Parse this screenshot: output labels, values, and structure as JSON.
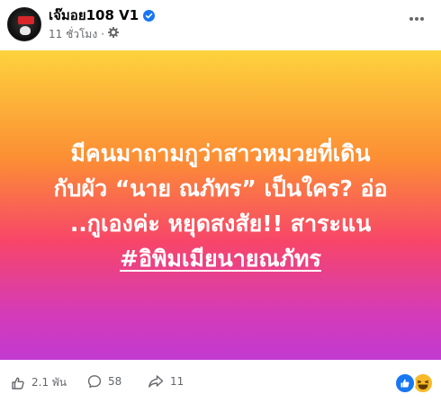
{
  "header": {
    "page_name": "เจ๊มอย108 V1",
    "time_text": "11 ชั่วโมง",
    "separator": "·"
  },
  "post": {
    "text_lines": [
      "มีคนมาถามกูว่าสาวหมวยที่เดิน",
      "กับผัว “นาย ณภัทร” เป็นใคร? อ่อ",
      "..กูเองค่ะ หยุดสงสัย!! สาระแน"
    ],
    "hashtag": "#อิพิมเมียนายณภัทร"
  },
  "footer": {
    "like_count": "2.1 พัน",
    "comment_count": "58",
    "share_count": "11"
  },
  "colors": {
    "brand_blue": "#1877f2",
    "gradient_top": "#fdd33d",
    "gradient_mid": "#f7456a",
    "gradient_bottom": "#c13ad0",
    "haha_yellow": "#f7b928",
    "meta_gray": "#65676b"
  },
  "icons": {
    "verified": "verified-badge-icon",
    "privacy": "public-gear-icon",
    "more": "more-options-icon",
    "like": "thumbs-up-icon",
    "comment": "comment-bubble-icon",
    "share": "share-arrow-icon",
    "reaction_like": "like-reaction-icon",
    "reaction_haha": "haha-reaction-icon"
  }
}
